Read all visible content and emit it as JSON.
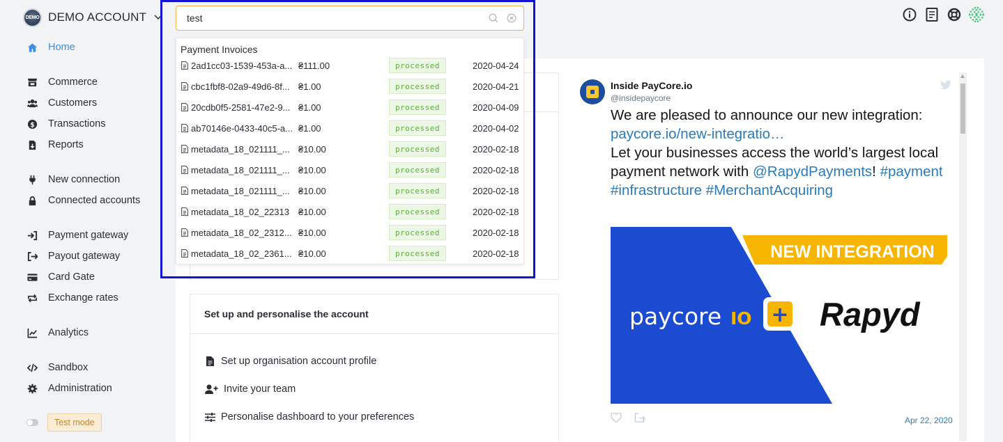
{
  "account": {
    "logo_text": "DEMO",
    "name": "DEMO ACCOUNT"
  },
  "nav": {
    "home": "Home",
    "commerce": "Commerce",
    "customers": "Customers",
    "transactions": "Transactions",
    "reports": "Reports",
    "new_connection": "New connection",
    "connected_accounts": "Connected accounts",
    "payment_gateway": "Payment gateway",
    "payout_gateway": "Payout gateway",
    "card_gate": "Card Gate",
    "exchange_rates": "Exchange rates",
    "analytics": "Analytics",
    "sandbox": "Sandbox",
    "administration": "Administration"
  },
  "test_mode": {
    "label": "Test mode"
  },
  "search": {
    "value": "test",
    "section_title": "Payment Invoices",
    "results": [
      {
        "id": "2ad1cc03-1539-453a-a...",
        "amount": "₴111.00",
        "status": "processed",
        "date": "2020-04-24"
      },
      {
        "id": "cbc1fbf8-02a9-49d6-8f...",
        "amount": "₴1.00",
        "status": "processed",
        "date": "2020-04-21"
      },
      {
        "id": "20cdb0f5-2581-47e2-9...",
        "amount": "₴1.00",
        "status": "processed",
        "date": "2020-04-09"
      },
      {
        "id": "ab70146e-0433-40c5-a...",
        "amount": "₴1.00",
        "status": "processed",
        "date": "2020-04-02"
      },
      {
        "id": "metadata_18_021111_...",
        "amount": "₴10.00",
        "status": "processed",
        "date": "2020-02-18"
      },
      {
        "id": "metadata_18_021111_...",
        "amount": "₴10.00",
        "status": "processed",
        "date": "2020-02-18"
      },
      {
        "id": "metadata_18_021111_...",
        "amount": "₴10.00",
        "status": "processed",
        "date": "2020-02-18"
      },
      {
        "id": "metadata_18_02_22313",
        "amount": "₴10.00",
        "status": "processed",
        "date": "2020-02-18"
      },
      {
        "id": "metadata_18_02_2312...",
        "amount": "₴10.00",
        "status": "processed",
        "date": "2020-02-18"
      },
      {
        "id": "metadata_18_02_2361...",
        "amount": "₴10.00",
        "status": "processed",
        "date": "2020-02-18"
      }
    ]
  },
  "setup_card": {
    "title": "Set up and personalise the account",
    "items": [
      "Set up organisation account profile",
      "Invite your team",
      "Personalise dashboard to your preferences"
    ]
  },
  "tweet": {
    "name": "Inside PayCore.io",
    "handle": "@insidepaycore",
    "text_1": "We are pleased to announce our new integration:",
    "link_1": "paycore.io/new-integratio…",
    "text_2": "Let your businesses access the world’s largest local payment network with ",
    "mention": "@RapydPayments",
    "text_3": "! ",
    "hashtag_1": "#payment",
    "hashtag_2": "#infrastructure",
    "hashtag_3": "#MerchantAcquiring",
    "banner": "NEW INTEGRATION",
    "brand_1": "paycore",
    "brand_1_suffix": "IO",
    "plus": "+",
    "brand_2": "Rapyd",
    "date": "Apr 22, 2020"
  },
  "colors": {
    "accent": "#3f8ee0",
    "highlight_border": "#1313d6",
    "status_green": "#5fae3f",
    "tweet_link": "#2b7bb9",
    "brand_blue": "#1d4ed8",
    "brand_yellow": "#f7b500"
  },
  "icons": {
    "search": "search-icon",
    "clear": "clear-circle-icon",
    "info": "info-icon",
    "docs": "book-icon",
    "support": "lifebuoy-icon",
    "avatar": "pattern-avatar-icon"
  }
}
